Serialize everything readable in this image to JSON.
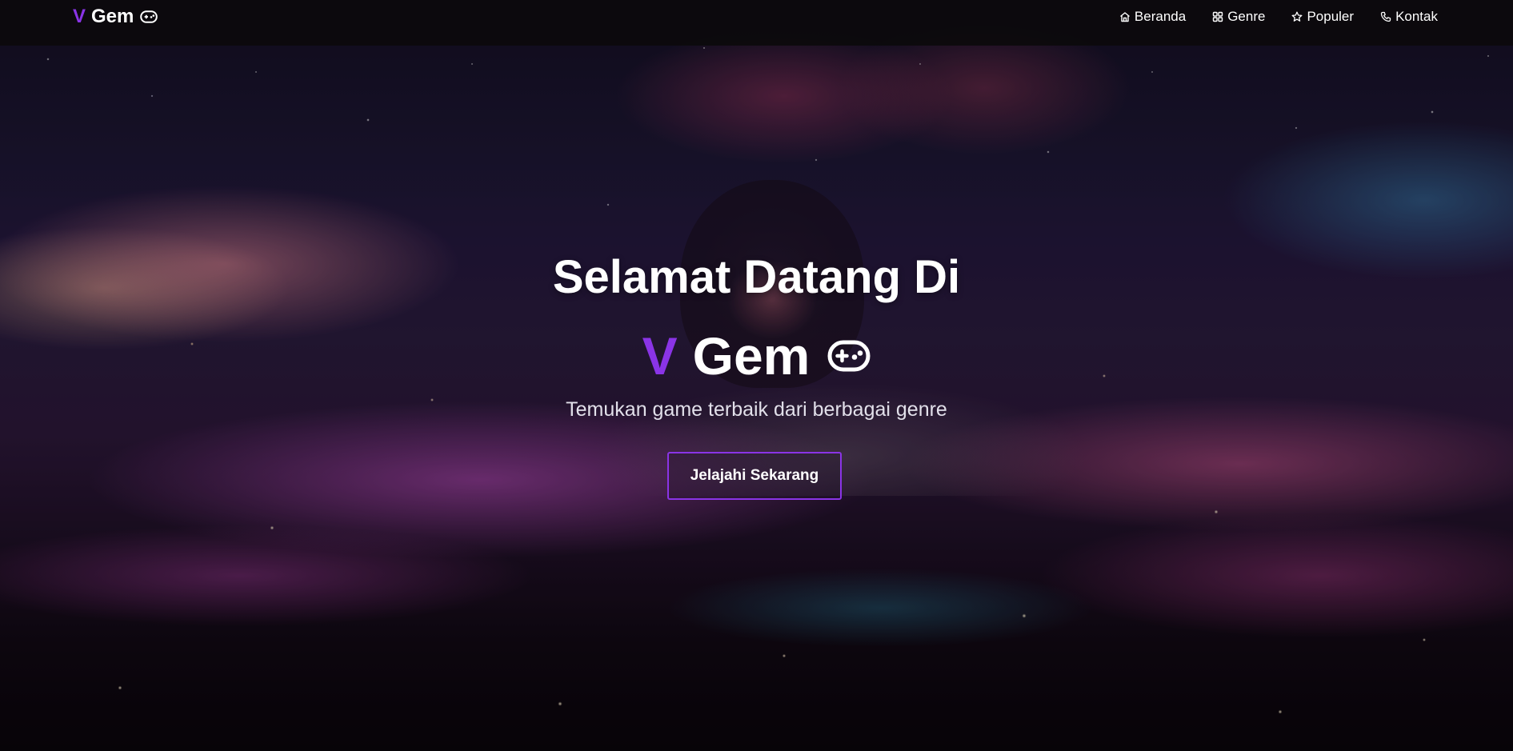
{
  "brand": {
    "v": "V",
    "name": "Gem",
    "icon": "gamepad-icon"
  },
  "nav": {
    "items": [
      {
        "label": "Beranda",
        "icon": "home-icon"
      },
      {
        "label": "Genre",
        "icon": "grid-icon"
      },
      {
        "label": "Populer",
        "icon": "star-icon"
      },
      {
        "label": "Kontak",
        "icon": "phone-icon"
      }
    ]
  },
  "hero": {
    "title": "Selamat Datang Di",
    "brand_v": "V",
    "brand_name": "Gem",
    "subtitle": "Temukan game terbaik dari berbagai genre",
    "cta_label": "Jelajahi Sekarang"
  },
  "colors": {
    "accent": "#8a34e6",
    "navbar_bg": "#0c0a0c",
    "text": "#ffffff"
  }
}
